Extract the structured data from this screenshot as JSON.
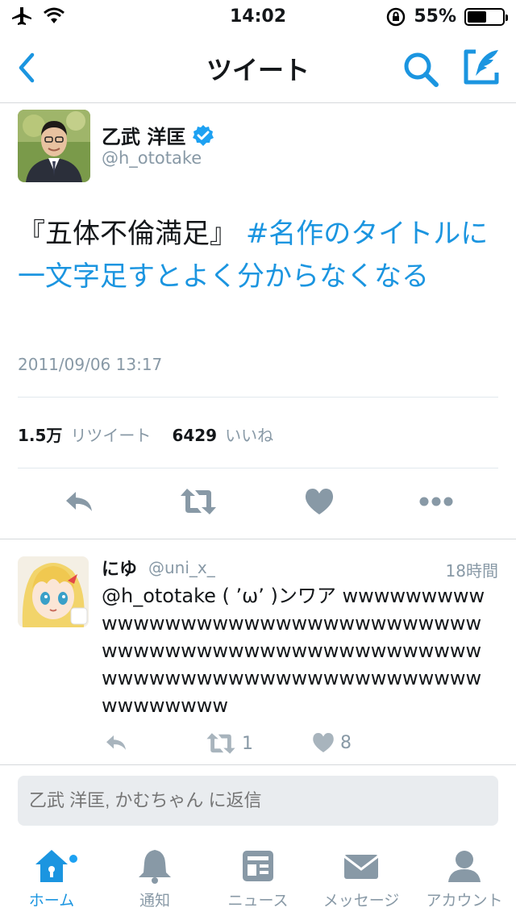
{
  "status_bar": {
    "time": "14:02",
    "battery_percent": "55%",
    "battery_level": 0.55
  },
  "nav": {
    "title": "ツイート",
    "back_icon": "chevron-left-icon",
    "search_icon": "search-icon",
    "compose_icon": "compose-icon"
  },
  "tweet": {
    "author_name": "乙武 洋匡",
    "author_handle": "@h_ototake",
    "text_plain": "『五体不倫満足』 ",
    "text_hashtag": "#名作のタイトルに一文字足すとよく分からなくなる",
    "date": "2011/09/06 13:17",
    "retweet_count": "1.5万",
    "retweet_label": "リツイート",
    "like_count": "6429",
    "like_label": "いいね"
  },
  "reply": {
    "name": "にゆ",
    "handle": "@uni_x_",
    "time": "18時間",
    "text": "@h_ototake ( ’ω’ )ンワア wwwwwwwwwwwwwwwwwwwwwwwwwwwwwwwwwwwwwwwwwwwwwwwwwwwwwwwwwwwwwwwwwwwwwwwwwwwwwwwwwwwwwwwww",
    "retweet_count": "1",
    "like_count": "8"
  },
  "reply_box": {
    "placeholder": "乙武 洋匡, かむちゃん に返信"
  },
  "tabbar": {
    "home": "ホーム",
    "notifications": "通知",
    "news": "ニュース",
    "messages": "メッセージ",
    "account": "アカウント"
  },
  "colors": {
    "accent": "#1b95e0",
    "muted": "#8899a6",
    "action_icon": "#8899a6"
  }
}
